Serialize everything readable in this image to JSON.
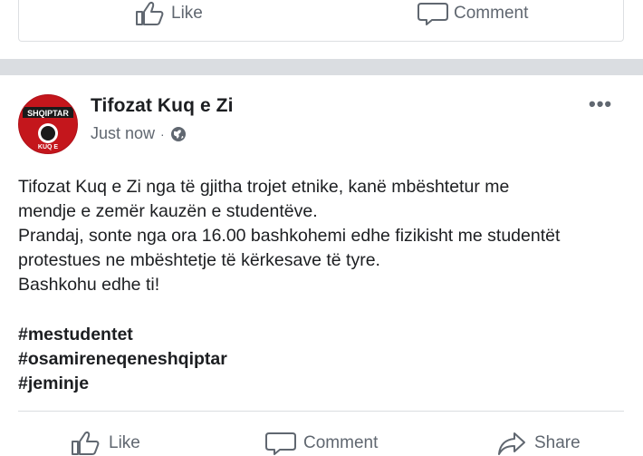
{
  "previous_post": {
    "like_label": "Like",
    "comment_label": "Comment"
  },
  "post": {
    "author": "Tifozat Kuq e Zi",
    "avatar_text_top": "SHQIPTAR",
    "avatar_text_bottom": "KUQ E",
    "timestamp": "Just now",
    "visibility_icon": "globe-icon",
    "more_icon": "•••",
    "text_lines": [
      "Tifozat Kuq e Zi nga të gjitha trojet etnike, kanë mbështetur me",
      "mendje e zemër kauzën e studentëve.",
      "Prandaj, sonte nga ora 16.00  bashkohemi edhe fizikisht me studentët",
      "protestues ne mbështetje të kërkesave të tyre.",
      "Bashkohu edhe ti!"
    ],
    "hashtags": [
      "#mestudentet",
      "#osamireneqeneshqiptar",
      "#jeminje"
    ],
    "actions": {
      "like_label": "Like",
      "comment_label": "Comment",
      "share_label": "Share"
    }
  },
  "colors": {
    "text": "#1c1e21",
    "secondary": "#606770",
    "separator": "#dadde1",
    "avatar_red": "#c4161c"
  }
}
